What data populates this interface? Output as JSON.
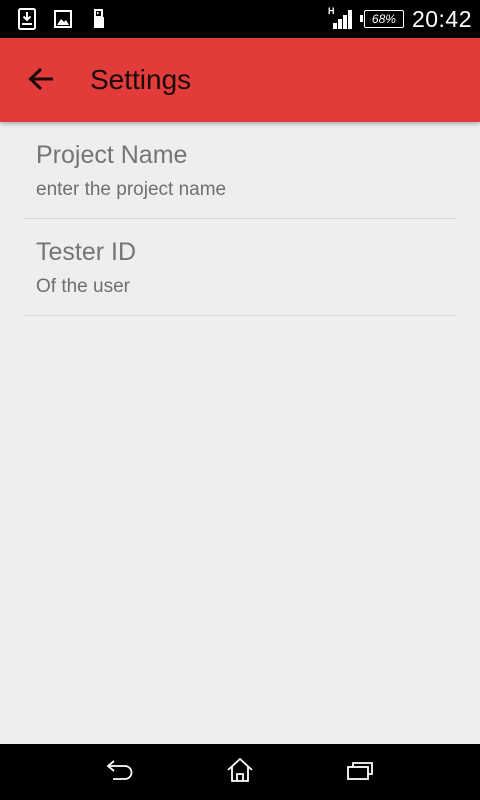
{
  "status_bar": {
    "network_type": "H",
    "battery_level": "68%",
    "time": "20:42",
    "notification_icons": [
      "download-icon",
      "image-icon",
      "usb-icon"
    ]
  },
  "app_bar": {
    "title": "Settings",
    "back_icon": "arrow-back-icon",
    "color": "#e23c3a"
  },
  "preferences": [
    {
      "title": "Project Name",
      "summary": "enter the project name"
    },
    {
      "title": "Tester ID",
      "summary": "Of the user"
    }
  ],
  "nav_bar": {
    "buttons": [
      "back-icon",
      "home-icon",
      "recents-icon"
    ]
  }
}
